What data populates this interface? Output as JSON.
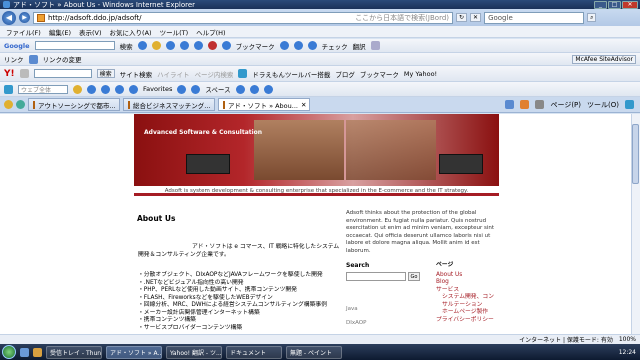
{
  "window": {
    "title": "アド・ソフト » About Us - Windows Internet Explorer",
    "min": "_",
    "max": "□",
    "close": "✕"
  },
  "address": {
    "url": "http://adsoft.ddo.jp/adsoft/",
    "translate_hint": "ここから日本語で検索(JBord)",
    "search_placeholder": "Google"
  },
  "menu": [
    "ファイル(F)",
    "編集(E)",
    "表示(V)",
    "お気に入り(A)",
    "ツール(T)",
    "ヘルプ(H)"
  ],
  "google_bar": {
    "logo": "Google",
    "search_label": "検索",
    "bookmarks": "ブックマーク",
    "check": "チェック",
    "translate": "翻訳"
  },
  "links_bar": {
    "label": "リンク",
    "changes": "リンクの変更",
    "mcafee": "McAfee SiteAdvisor"
  },
  "yahoo_bar": {
    "logo": "Y!",
    "search_label": "検索",
    "site_search": "サイト検索",
    "highlight": "ハイライト",
    "page_search": "ページ内検索",
    "doraemon": "ドラえもんツールバー搭載",
    "blog": "ブログ",
    "bookmark": "ブックマーク",
    "myyahoo": "My Yahoo!"
  },
  "web_bar": {
    "placeholder": "ウェブ全体",
    "favorites": "Favorites",
    "space": "スペース"
  },
  "tabs": [
    {
      "title": "アウトソーシングで都市..."
    },
    {
      "title": "総合ビジネスマッチング..."
    },
    {
      "title": "アド・ソフト » Abou..."
    }
  ],
  "tab_tools": {
    "page": "ページ(P)",
    "tools": "ツール(O)"
  },
  "site": {
    "brand": "Advanced Software & Consultation",
    "tagline": "Adsoft is system development & consulting enterprise that specialized in the E-commerce and the IT strategy.",
    "heading": "About Us",
    "intro": "アド・ソフトは e コマース、IT 戦略に特化したシステム開発＆コンサルティング企業です。",
    "bullets": [
      "・分散オブジェクト、DIxAOPなどJAVAフレームワークを駆使した開発",
      "・.NETなどビジュアル指向性の高い開発",
      "・PHP、PERLなど使用した動画サイト、携帯コンテンツ開発",
      "・FLASH、Fireworksなどを駆使したWEBデザイン",
      "・回線分析、MRC、DWHによる経営システムコンサルティング構築事例",
      "・メーカー設計店関係管理インターネット構築",
      "・携帯コンテンツ構築",
      "・サービスプロバイダーコンテンツ構築"
    ],
    "about_text": "Adsoft thinks about the protection of the global environment. Eu fugiat nulla pariatur. Quis nostrud exercitation ut enim ad minim veniam, excepteur sint occaecat. Qui officia deserunt ullamco laboris nisi ut labore et dolore magna aliqua. Mollit anim id est laborum.",
    "search_title": "Search",
    "search_button": "Go",
    "categories": [
      "Java",
      "DIxAOP"
    ],
    "pages_title": "ページ",
    "pages": [
      "About Us",
      "Blog",
      "サービス"
    ],
    "subpages": [
      "システム開発、コンサルテーション",
      "ホームページ製作"
    ],
    "pages_more": [
      "プライバシーポリシー"
    ]
  },
  "status": {
    "zone": "インターネット | 保護モード: 有効",
    "zoom": "100%"
  },
  "taskbar": {
    "items": [
      "受信トレイ - Thun...",
      "アド・ソフト » A...",
      "Yahoo! 翻訳 - ツ...",
      "ドキュメント",
      "無題 - ペイント"
    ],
    "clock": "12:24"
  },
  "colors": {
    "brand_red": "#a51c24",
    "title_bar": "#1a3158",
    "tab_bg": "#c9d9ee"
  }
}
